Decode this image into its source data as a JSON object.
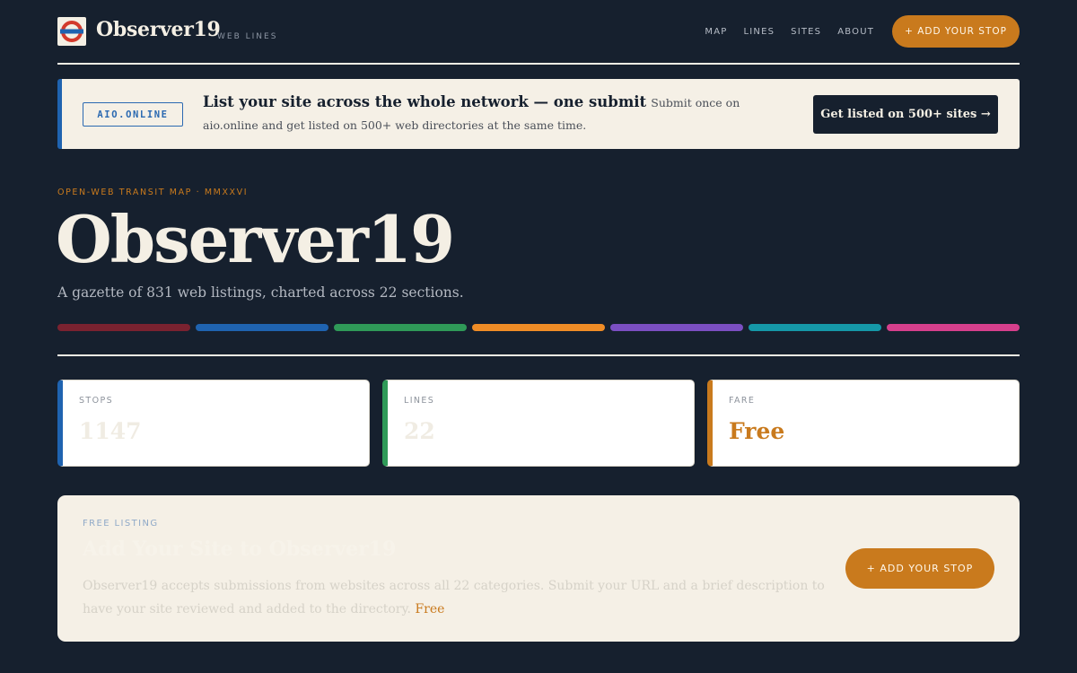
{
  "header": {
    "brand": "Observer19",
    "brand_sub": "WEB LINES",
    "nav": [
      "MAP",
      "LINES",
      "SITES",
      "ABOUT"
    ],
    "cta": "+ ADD YOUR STOP",
    "logo_icon": "roundel-icon"
  },
  "banner": {
    "tag": "AIO.ONLINE",
    "title": "List your site across the whole network — one submit",
    "description": "Submit once on aio.online and get listed on 500+ web directories at the same time.",
    "button": "Get listed on 500+ sites →"
  },
  "hero": {
    "eyebrow": "OPEN-WEB TRANSIT MAP · MMXXVI",
    "title": "Observer19",
    "subtitle": "A gazette of 831 web listings, charted across 22 sections.",
    "line_colors": [
      "#7a2230",
      "#1f63b0",
      "#2f9a58",
      "#ef8c26",
      "#7b4fc2",
      "#1598a8",
      "#d63f8c"
    ]
  },
  "stats": [
    {
      "label": "STOPS",
      "value": "1147",
      "color": "#1f63b0"
    },
    {
      "label": "LINES",
      "value": "22",
      "color": "#2f9a58"
    },
    {
      "label": "FARE",
      "value": "Free",
      "color": "#c97a1d"
    }
  ],
  "listing": {
    "eyebrow": "FREE LISTING",
    "title": "Add Your Site to Observer19",
    "description": "Observer19 accepts submissions from websites across all 22 categories. Submit your URL and a brief description to have your site reviewed and added to the directory.",
    "free_label": "Free",
    "button": "+ ADD YOUR STOP"
  },
  "colors": {
    "background": "#16202e",
    "accent": "#c97a1d",
    "cream": "#f5f0e6"
  }
}
